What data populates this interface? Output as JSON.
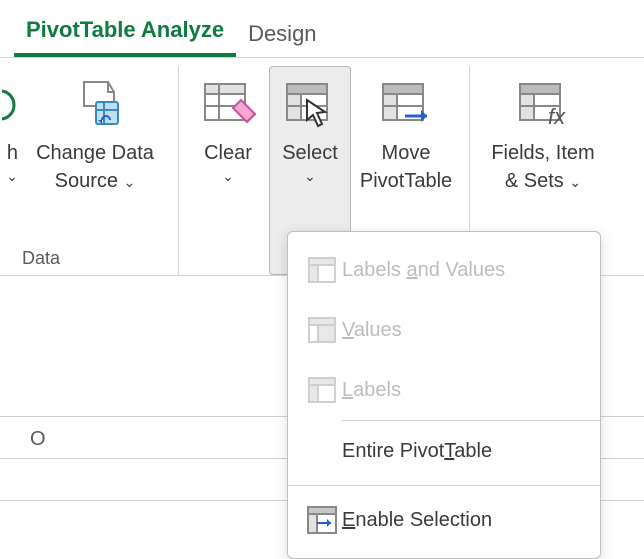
{
  "tabs": {
    "analyze": "PivotTable Analyze",
    "design": "Design"
  },
  "ribbon": {
    "refresh_partial": "h",
    "change_data": "Change Data",
    "source": "Source",
    "clear": "Clear",
    "select": "Select",
    "move": "Move",
    "pivottable": "PivotTable",
    "fields_items": "Fields, Item",
    "and_sets": "& Sets",
    "group_data": "Data"
  },
  "menu": {
    "labels_and_values": "Labels and Values",
    "values": "Values",
    "labels": "Labels",
    "entire_pivot": "Entire PivotTable",
    "enable_selection": "Enable Selection"
  },
  "sheet": {
    "col_o": "O"
  }
}
